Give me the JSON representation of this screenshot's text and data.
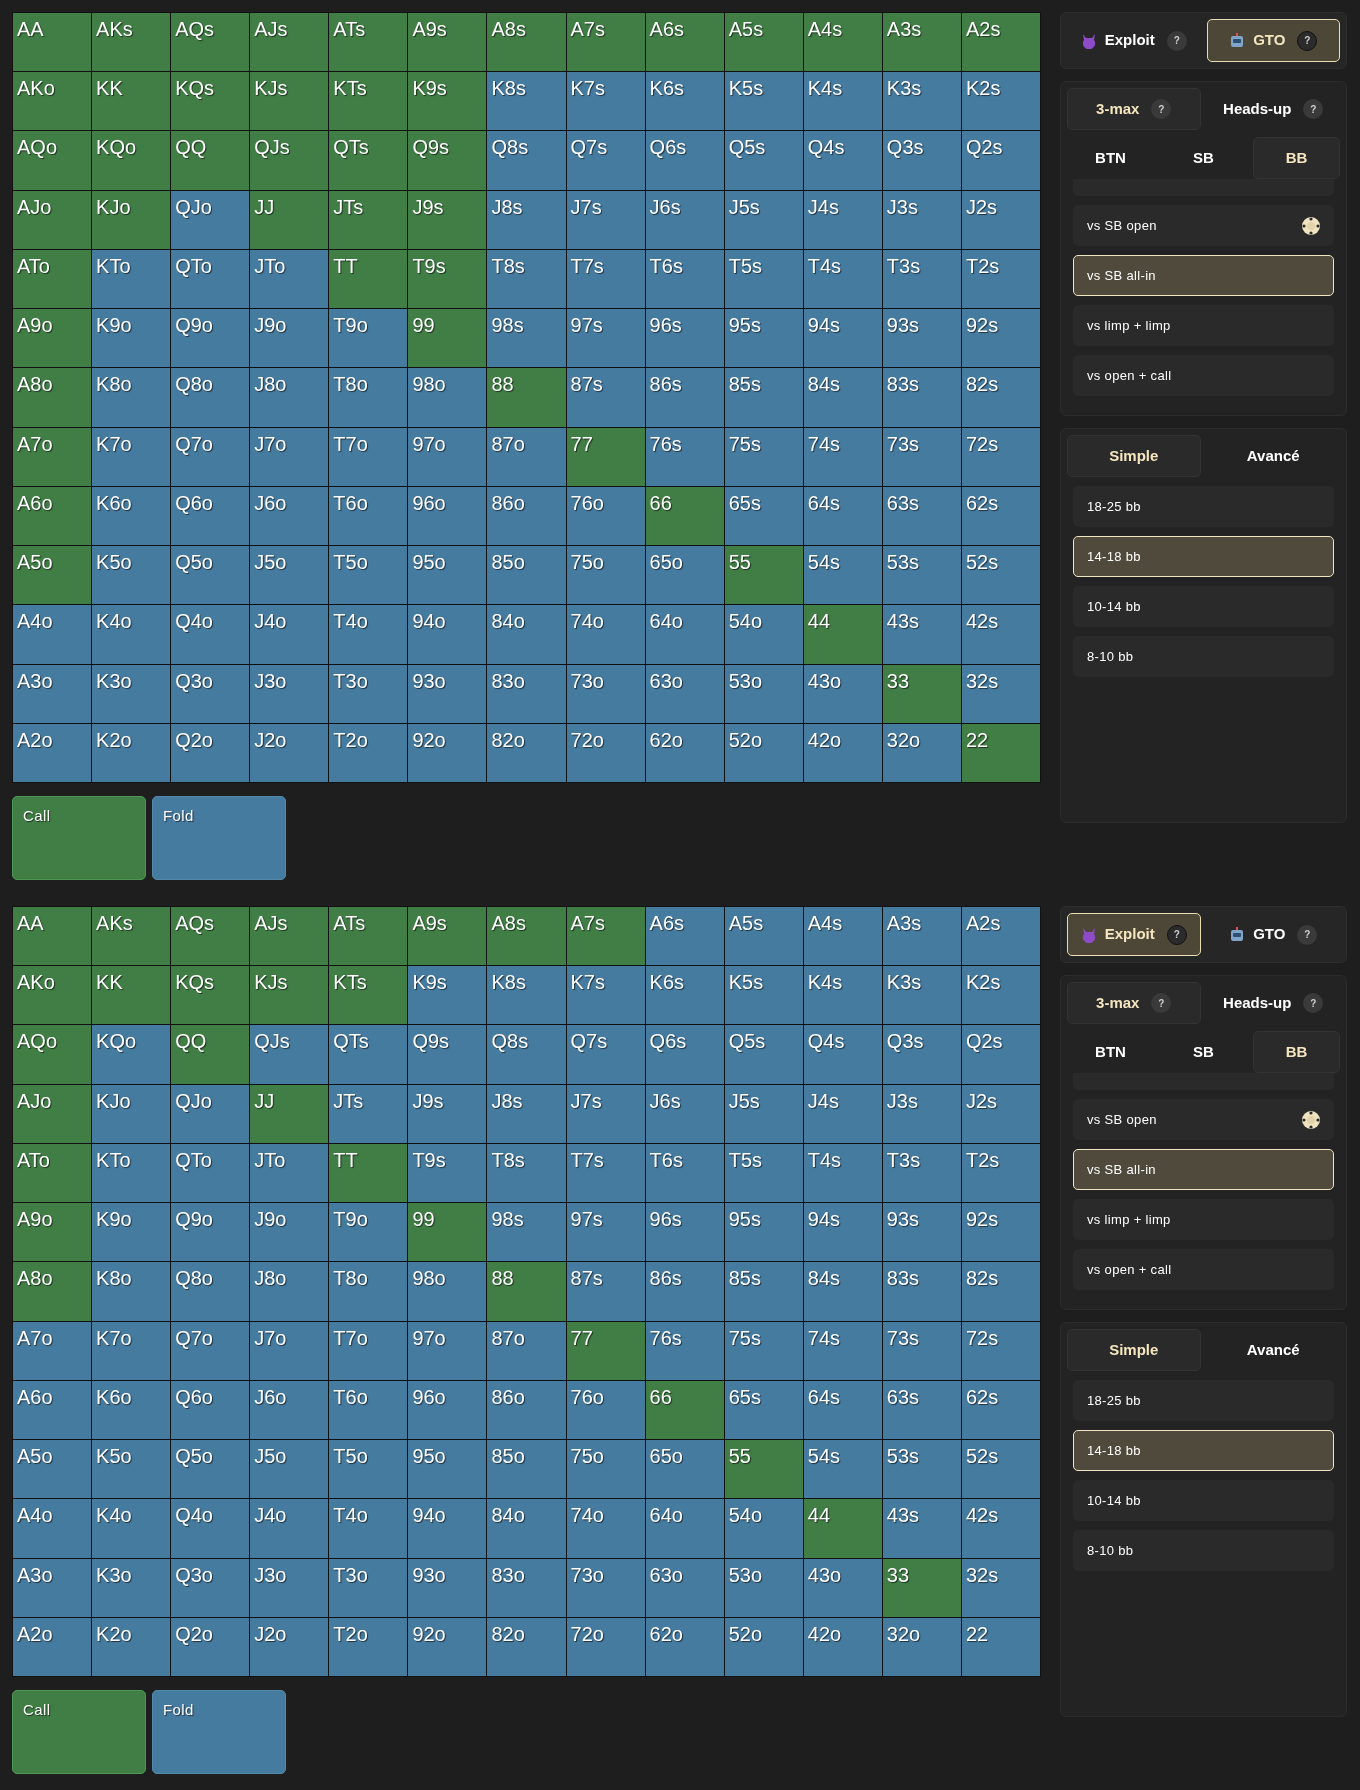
{
  "sections": [
    {
      "grid": {
        "rows": [
          {
            "cells": [
              {
                "hand": "AA",
                "kind": "call"
              },
              {
                "hand": "AKs",
                "kind": "call"
              },
              {
                "hand": "AQs",
                "kind": "call"
              },
              {
                "hand": "AJs",
                "kind": "call"
              },
              {
                "hand": "ATs",
                "kind": "call"
              },
              {
                "hand": "A9s",
                "kind": "call"
              },
              {
                "hand": "A8s",
                "kind": "call"
              },
              {
                "hand": "A7s",
                "kind": "call"
              },
              {
                "hand": "A6s",
                "kind": "call"
              },
              {
                "hand": "A5s",
                "kind": "call"
              },
              {
                "hand": "A4s",
                "kind": "call"
              },
              {
                "hand": "A3s",
                "kind": "call"
              },
              {
                "hand": "A2s",
                "kind": "call"
              }
            ]
          },
          {
            "cells": [
              {
                "hand": "AKo",
                "kind": "call"
              },
              {
                "hand": "KK",
                "kind": "call"
              },
              {
                "hand": "KQs",
                "kind": "call"
              },
              {
                "hand": "KJs",
                "kind": "call"
              },
              {
                "hand": "KTs",
                "kind": "call"
              },
              {
                "hand": "K9s",
                "kind": "call"
              },
              {
                "hand": "K8s",
                "kind": "fold"
              },
              {
                "hand": "K7s",
                "kind": "fold"
              },
              {
                "hand": "K6s",
                "kind": "fold"
              },
              {
                "hand": "K5s",
                "kind": "fold"
              },
              {
                "hand": "K4s",
                "kind": "fold"
              },
              {
                "hand": "K3s",
                "kind": "fold"
              },
              {
                "hand": "K2s",
                "kind": "fold"
              }
            ]
          },
          {
            "cells": [
              {
                "hand": "AQo",
                "kind": "call"
              },
              {
                "hand": "KQo",
                "kind": "call"
              },
              {
                "hand": "QQ",
                "kind": "call"
              },
              {
                "hand": "QJs",
                "kind": "call"
              },
              {
                "hand": "QTs",
                "kind": "call"
              },
              {
                "hand": "Q9s",
                "kind": "call"
              },
              {
                "hand": "Q8s",
                "kind": "fold"
              },
              {
                "hand": "Q7s",
                "kind": "fold"
              },
              {
                "hand": "Q6s",
                "kind": "fold"
              },
              {
                "hand": "Q5s",
                "kind": "fold"
              },
              {
                "hand": "Q4s",
                "kind": "fold"
              },
              {
                "hand": "Q3s",
                "kind": "fold"
              },
              {
                "hand": "Q2s",
                "kind": "fold"
              }
            ]
          },
          {
            "cells": [
              {
                "hand": "AJo",
                "kind": "call"
              },
              {
                "hand": "KJo",
                "kind": "call"
              },
              {
                "hand": "QJo",
                "kind": "fold"
              },
              {
                "hand": "JJ",
                "kind": "call"
              },
              {
                "hand": "JTs",
                "kind": "call"
              },
              {
                "hand": "J9s",
                "kind": "call"
              },
              {
                "hand": "J8s",
                "kind": "fold"
              },
              {
                "hand": "J7s",
                "kind": "fold"
              },
              {
                "hand": "J6s",
                "kind": "fold"
              },
              {
                "hand": "J5s",
                "kind": "fold"
              },
              {
                "hand": "J4s",
                "kind": "fold"
              },
              {
                "hand": "J3s",
                "kind": "fold"
              },
              {
                "hand": "J2s",
                "kind": "fold"
              }
            ]
          },
          {
            "cells": [
              {
                "hand": "ATo",
                "kind": "call"
              },
              {
                "hand": "KTo",
                "kind": "fold"
              },
              {
                "hand": "QTo",
                "kind": "fold"
              },
              {
                "hand": "JTo",
                "kind": "fold"
              },
              {
                "hand": "TT",
                "kind": "call"
              },
              {
                "hand": "T9s",
                "kind": "call"
              },
              {
                "hand": "T8s",
                "kind": "fold"
              },
              {
                "hand": "T7s",
                "kind": "fold"
              },
              {
                "hand": "T6s",
                "kind": "fold"
              },
              {
                "hand": "T5s",
                "kind": "fold"
              },
              {
                "hand": "T4s",
                "kind": "fold"
              },
              {
                "hand": "T3s",
                "kind": "fold"
              },
              {
                "hand": "T2s",
                "kind": "fold"
              }
            ]
          },
          {
            "cells": [
              {
                "hand": "A9o",
                "kind": "call"
              },
              {
                "hand": "K9o",
                "kind": "fold"
              },
              {
                "hand": "Q9o",
                "kind": "fold"
              },
              {
                "hand": "J9o",
                "kind": "fold"
              },
              {
                "hand": "T9o",
                "kind": "fold"
              },
              {
                "hand": "99",
                "kind": "call"
              },
              {
                "hand": "98s",
                "kind": "fold"
              },
              {
                "hand": "97s",
                "kind": "fold"
              },
              {
                "hand": "96s",
                "kind": "fold"
              },
              {
                "hand": "95s",
                "kind": "fold"
              },
              {
                "hand": "94s",
                "kind": "fold"
              },
              {
                "hand": "93s",
                "kind": "fold"
              },
              {
                "hand": "92s",
                "kind": "fold"
              }
            ]
          },
          {
            "cells": [
              {
                "hand": "A8o",
                "kind": "call"
              },
              {
                "hand": "K8o",
                "kind": "fold"
              },
              {
                "hand": "Q8o",
                "kind": "fold"
              },
              {
                "hand": "J8o",
                "kind": "fold"
              },
              {
                "hand": "T8o",
                "kind": "fold"
              },
              {
                "hand": "98o",
                "kind": "fold"
              },
              {
                "hand": "88",
                "kind": "call"
              },
              {
                "hand": "87s",
                "kind": "fold"
              },
              {
                "hand": "86s",
                "kind": "fold"
              },
              {
                "hand": "85s",
                "kind": "fold"
              },
              {
                "hand": "84s",
                "kind": "fold"
              },
              {
                "hand": "83s",
                "kind": "fold"
              },
              {
                "hand": "82s",
                "kind": "fold"
              }
            ]
          },
          {
            "cells": [
              {
                "hand": "A7o",
                "kind": "call"
              },
              {
                "hand": "K7o",
                "kind": "fold"
              },
              {
                "hand": "Q7o",
                "kind": "fold"
              },
              {
                "hand": "J7o",
                "kind": "fold"
              },
              {
                "hand": "T7o",
                "kind": "fold"
              },
              {
                "hand": "97o",
                "kind": "fold"
              },
              {
                "hand": "87o",
                "kind": "fold"
              },
              {
                "hand": "77",
                "kind": "call"
              },
              {
                "hand": "76s",
                "kind": "fold"
              },
              {
                "hand": "75s",
                "kind": "fold"
              },
              {
                "hand": "74s",
                "kind": "fold"
              },
              {
                "hand": "73s",
                "kind": "fold"
              },
              {
                "hand": "72s",
                "kind": "fold"
              }
            ]
          },
          {
            "cells": [
              {
                "hand": "A6o",
                "kind": "call"
              },
              {
                "hand": "K6o",
                "kind": "fold"
              },
              {
                "hand": "Q6o",
                "kind": "fold"
              },
              {
                "hand": "J6o",
                "kind": "fold"
              },
              {
                "hand": "T6o",
                "kind": "fold"
              },
              {
                "hand": "96o",
                "kind": "fold"
              },
              {
                "hand": "86o",
                "kind": "fold"
              },
              {
                "hand": "76o",
                "kind": "fold"
              },
              {
                "hand": "66",
                "kind": "call"
              },
              {
                "hand": "65s",
                "kind": "fold"
              },
              {
                "hand": "64s",
                "kind": "fold"
              },
              {
                "hand": "63s",
                "kind": "fold"
              },
              {
                "hand": "62s",
                "kind": "fold"
              }
            ]
          },
          {
            "cells": [
              {
                "hand": "A5o",
                "kind": "call"
              },
              {
                "hand": "K5o",
                "kind": "fold"
              },
              {
                "hand": "Q5o",
                "kind": "fold"
              },
              {
                "hand": "J5o",
                "kind": "fold"
              },
              {
                "hand": "T5o",
                "kind": "fold"
              },
              {
                "hand": "95o",
                "kind": "fold"
              },
              {
                "hand": "85o",
                "kind": "fold"
              },
              {
                "hand": "75o",
                "kind": "fold"
              },
              {
                "hand": "65o",
                "kind": "fold"
              },
              {
                "hand": "55",
                "kind": "call"
              },
              {
                "hand": "54s",
                "kind": "fold"
              },
              {
                "hand": "53s",
                "kind": "fold"
              },
              {
                "hand": "52s",
                "kind": "fold"
              }
            ]
          },
          {
            "cells": [
              {
                "hand": "A4o",
                "kind": "fold"
              },
              {
                "hand": "K4o",
                "kind": "fold"
              },
              {
                "hand": "Q4o",
                "kind": "fold"
              },
              {
                "hand": "J4o",
                "kind": "fold"
              },
              {
                "hand": "T4o",
                "kind": "fold"
              },
              {
                "hand": "94o",
                "kind": "fold"
              },
              {
                "hand": "84o",
                "kind": "fold"
              },
              {
                "hand": "74o",
                "kind": "fold"
              },
              {
                "hand": "64o",
                "kind": "fold"
              },
              {
                "hand": "54o",
                "kind": "fold"
              },
              {
                "hand": "44",
                "kind": "call"
              },
              {
                "hand": "43s",
                "kind": "fold"
              },
              {
                "hand": "42s",
                "kind": "fold"
              }
            ]
          },
          {
            "cells": [
              {
                "hand": "A3o",
                "kind": "fold"
              },
              {
                "hand": "K3o",
                "kind": "fold"
              },
              {
                "hand": "Q3o",
                "kind": "fold"
              },
              {
                "hand": "J3o",
                "kind": "fold"
              },
              {
                "hand": "T3o",
                "kind": "fold"
              },
              {
                "hand": "93o",
                "kind": "fold"
              },
              {
                "hand": "83o",
                "kind": "fold"
              },
              {
                "hand": "73o",
                "kind": "fold"
              },
              {
                "hand": "63o",
                "kind": "fold"
              },
              {
                "hand": "53o",
                "kind": "fold"
              },
              {
                "hand": "43o",
                "kind": "fold"
              },
              {
                "hand": "33",
                "kind": "call"
              },
              {
                "hand": "32s",
                "kind": "fold"
              }
            ]
          },
          {
            "cells": [
              {
                "hand": "A2o",
                "kind": "fold"
              },
              {
                "hand": "K2o",
                "kind": "fold"
              },
              {
                "hand": "Q2o",
                "kind": "fold"
              },
              {
                "hand": "J2o",
                "kind": "fold"
              },
              {
                "hand": "T2o",
                "kind": "fold"
              },
              {
                "hand": "92o",
                "kind": "fold"
              },
              {
                "hand": "82o",
                "kind": "fold"
              },
              {
                "hand": "72o",
                "kind": "fold"
              },
              {
                "hand": "62o",
                "kind": "fold"
              },
              {
                "hand": "52o",
                "kind": "fold"
              },
              {
                "hand": "42o",
                "kind": "fold"
              },
              {
                "hand": "32o",
                "kind": "fold"
              },
              {
                "hand": "22",
                "kind": "call"
              }
            ]
          }
        ]
      },
      "legend": [
        {
          "label": "Call",
          "kind": "call"
        },
        {
          "label": "Fold",
          "kind": "fold"
        }
      ],
      "panel": {
        "modes": [
          {
            "label": "Exploit",
            "kind": "devil",
            "help": "?",
            "selected": false
          },
          {
            "label": "GTO",
            "kind": "robot",
            "help": "?",
            "selected": true
          }
        ],
        "formats": [
          {
            "label": "3-max",
            "help": "?",
            "selected": true
          },
          {
            "label": "Heads-up",
            "help": "?",
            "selected": false
          }
        ],
        "positions": [
          {
            "label": "BTN",
            "selected": false
          },
          {
            "label": "SB",
            "selected": false
          },
          {
            "label": "BB",
            "selected": true
          }
        ],
        "scenarios": [
          {
            "selected": false,
            "chip": false
          },
          {
            "label": "vs SB open",
            "selected": false,
            "chip": true
          },
          {
            "label": "vs SB all-in",
            "selected": true,
            "chip": false
          },
          {
            "label": "vs limp + limp",
            "selected": false,
            "chip": false
          },
          {
            "label": "vs open + call",
            "selected": false,
            "chip": false
          }
        ],
        "levels": [
          {
            "label": "Simple",
            "selected": true
          },
          {
            "label": "Avancé",
            "selected": false
          }
        ],
        "stacks": [
          {
            "label": "18-25 bb",
            "selected": false
          },
          {
            "label": "14-18 bb",
            "selected": true
          },
          {
            "label": "10-14 bb",
            "selected": false
          },
          {
            "label": "8-10 bb",
            "selected": false
          }
        ]
      }
    },
    {
      "grid": {
        "rows": [
          {
            "cells": [
              {
                "hand": "AA",
                "kind": "call"
              },
              {
                "hand": "AKs",
                "kind": "call"
              },
              {
                "hand": "AQs",
                "kind": "call"
              },
              {
                "hand": "AJs",
                "kind": "call"
              },
              {
                "hand": "ATs",
                "kind": "call"
              },
              {
                "hand": "A9s",
                "kind": "call"
              },
              {
                "hand": "A8s",
                "kind": "call"
              },
              {
                "hand": "A7s",
                "kind": "call"
              },
              {
                "hand": "A6s",
                "kind": "fold"
              },
              {
                "hand": "A5s",
                "kind": "fold"
              },
              {
                "hand": "A4s",
                "kind": "fold"
              },
              {
                "hand": "A3s",
                "kind": "fold"
              },
              {
                "hand": "A2s",
                "kind": "fold"
              }
            ]
          },
          {
            "cells": [
              {
                "hand": "AKo",
                "kind": "call"
              },
              {
                "hand": "KK",
                "kind": "call"
              },
              {
                "hand": "KQs",
                "kind": "call"
              },
              {
                "hand": "KJs",
                "kind": "call"
              },
              {
                "hand": "KTs",
                "kind": "call"
              },
              {
                "hand": "K9s",
                "kind": "fold"
              },
              {
                "hand": "K8s",
                "kind": "fold"
              },
              {
                "hand": "K7s",
                "kind": "fold"
              },
              {
                "hand": "K6s",
                "kind": "fold"
              },
              {
                "hand": "K5s",
                "kind": "fold"
              },
              {
                "hand": "K4s",
                "kind": "fold"
              },
              {
                "hand": "K3s",
                "kind": "fold"
              },
              {
                "hand": "K2s",
                "kind": "fold"
              }
            ]
          },
          {
            "cells": [
              {
                "hand": "AQo",
                "kind": "call"
              },
              {
                "hand": "KQo",
                "kind": "fold"
              },
              {
                "hand": "QQ",
                "kind": "call"
              },
              {
                "hand": "QJs",
                "kind": "fold"
              },
              {
                "hand": "QTs",
                "kind": "fold"
              },
              {
                "hand": "Q9s",
                "kind": "fold"
              },
              {
                "hand": "Q8s",
                "kind": "fold"
              },
              {
                "hand": "Q7s",
                "kind": "fold"
              },
              {
                "hand": "Q6s",
                "kind": "fold"
              },
              {
                "hand": "Q5s",
                "kind": "fold"
              },
              {
                "hand": "Q4s",
                "kind": "fold"
              },
              {
                "hand": "Q3s",
                "kind": "fold"
              },
              {
                "hand": "Q2s",
                "kind": "fold"
              }
            ]
          },
          {
            "cells": [
              {
                "hand": "AJo",
                "kind": "call"
              },
              {
                "hand": "KJo",
                "kind": "fold"
              },
              {
                "hand": "QJo",
                "kind": "fold"
              },
              {
                "hand": "JJ",
                "kind": "call"
              },
              {
                "hand": "JTs",
                "kind": "fold"
              },
              {
                "hand": "J9s",
                "kind": "fold"
              },
              {
                "hand": "J8s",
                "kind": "fold"
              },
              {
                "hand": "J7s",
                "kind": "fold"
              },
              {
                "hand": "J6s",
                "kind": "fold"
              },
              {
                "hand": "J5s",
                "kind": "fold"
              },
              {
                "hand": "J4s",
                "kind": "fold"
              },
              {
                "hand": "J3s",
                "kind": "fold"
              },
              {
                "hand": "J2s",
                "kind": "fold"
              }
            ]
          },
          {
            "cells": [
              {
                "hand": "ATo",
                "kind": "call"
              },
              {
                "hand": "KTo",
                "kind": "fold"
              },
              {
                "hand": "QTo",
                "kind": "fold"
              },
              {
                "hand": "JTo",
                "kind": "fold"
              },
              {
                "hand": "TT",
                "kind": "call"
              },
              {
                "hand": "T9s",
                "kind": "fold"
              },
              {
                "hand": "T8s",
                "kind": "fold"
              },
              {
                "hand": "T7s",
                "kind": "fold"
              },
              {
                "hand": "T6s",
                "kind": "fold"
              },
              {
                "hand": "T5s",
                "kind": "fold"
              },
              {
                "hand": "T4s",
                "kind": "fold"
              },
              {
                "hand": "T3s",
                "kind": "fold"
              },
              {
                "hand": "T2s",
                "kind": "fold"
              }
            ]
          },
          {
            "cells": [
              {
                "hand": "A9o",
                "kind": "call"
              },
              {
                "hand": "K9o",
                "kind": "fold"
              },
              {
                "hand": "Q9o",
                "kind": "fold"
              },
              {
                "hand": "J9o",
                "kind": "fold"
              },
              {
                "hand": "T9o",
                "kind": "fold"
              },
              {
                "hand": "99",
                "kind": "call"
              },
              {
                "hand": "98s",
                "kind": "fold"
              },
              {
                "hand": "97s",
                "kind": "fold"
              },
              {
                "hand": "96s",
                "kind": "fold"
              },
              {
                "hand": "95s",
                "kind": "fold"
              },
              {
                "hand": "94s",
                "kind": "fold"
              },
              {
                "hand": "93s",
                "kind": "fold"
              },
              {
                "hand": "92s",
                "kind": "fold"
              }
            ]
          },
          {
            "cells": [
              {
                "hand": "A8o",
                "kind": "call"
              },
              {
                "hand": "K8o",
                "kind": "fold"
              },
              {
                "hand": "Q8o",
                "kind": "fold"
              },
              {
                "hand": "J8o",
                "kind": "fold"
              },
              {
                "hand": "T8o",
                "kind": "fold"
              },
              {
                "hand": "98o",
                "kind": "fold"
              },
              {
                "hand": "88",
                "kind": "call"
              },
              {
                "hand": "87s",
                "kind": "fold"
              },
              {
                "hand": "86s",
                "kind": "fold"
              },
              {
                "hand": "85s",
                "kind": "fold"
              },
              {
                "hand": "84s",
                "kind": "fold"
              },
              {
                "hand": "83s",
                "kind": "fold"
              },
              {
                "hand": "82s",
                "kind": "fold"
              }
            ]
          },
          {
            "cells": [
              {
                "hand": "A7o",
                "kind": "fold"
              },
              {
                "hand": "K7o",
                "kind": "fold"
              },
              {
                "hand": "Q7o",
                "kind": "fold"
              },
              {
                "hand": "J7o",
                "kind": "fold"
              },
              {
                "hand": "T7o",
                "kind": "fold"
              },
              {
                "hand": "97o",
                "kind": "fold"
              },
              {
                "hand": "87o",
                "kind": "fold"
              },
              {
                "hand": "77",
                "kind": "call"
              },
              {
                "hand": "76s",
                "kind": "fold"
              },
              {
                "hand": "75s",
                "kind": "fold"
              },
              {
                "hand": "74s",
                "kind": "fold"
              },
              {
                "hand": "73s",
                "kind": "fold"
              },
              {
                "hand": "72s",
                "kind": "fold"
              }
            ]
          },
          {
            "cells": [
              {
                "hand": "A6o",
                "kind": "fold"
              },
              {
                "hand": "K6o",
                "kind": "fold"
              },
              {
                "hand": "Q6o",
                "kind": "fold"
              },
              {
                "hand": "J6o",
                "kind": "fold"
              },
              {
                "hand": "T6o",
                "kind": "fold"
              },
              {
                "hand": "96o",
                "kind": "fold"
              },
              {
                "hand": "86o",
                "kind": "fold"
              },
              {
                "hand": "76o",
                "kind": "fold"
              },
              {
                "hand": "66",
                "kind": "call"
              },
              {
                "hand": "65s",
                "kind": "fold"
              },
              {
                "hand": "64s",
                "kind": "fold"
              },
              {
                "hand": "63s",
                "kind": "fold"
              },
              {
                "hand": "62s",
                "kind": "fold"
              }
            ]
          },
          {
            "cells": [
              {
                "hand": "A5o",
                "kind": "fold"
              },
              {
                "hand": "K5o",
                "kind": "fold"
              },
              {
                "hand": "Q5o",
                "kind": "fold"
              },
              {
                "hand": "J5o",
                "kind": "fold"
              },
              {
                "hand": "T5o",
                "kind": "fold"
              },
              {
                "hand": "95o",
                "kind": "fold"
              },
              {
                "hand": "85o",
                "kind": "fold"
              },
              {
                "hand": "75o",
                "kind": "fold"
              },
              {
                "hand": "65o",
                "kind": "fold"
              },
              {
                "hand": "55",
                "kind": "call"
              },
              {
                "hand": "54s",
                "kind": "fold"
              },
              {
                "hand": "53s",
                "kind": "fold"
              },
              {
                "hand": "52s",
                "kind": "fold"
              }
            ]
          },
          {
            "cells": [
              {
                "hand": "A4o",
                "kind": "fold"
              },
              {
                "hand": "K4o",
                "kind": "fold"
              },
              {
                "hand": "Q4o",
                "kind": "fold"
              },
              {
                "hand": "J4o",
                "kind": "fold"
              },
              {
                "hand": "T4o",
                "kind": "fold"
              },
              {
                "hand": "94o",
                "kind": "fold"
              },
              {
                "hand": "84o",
                "kind": "fold"
              },
              {
                "hand": "74o",
                "kind": "fold"
              },
              {
                "hand": "64o",
                "kind": "fold"
              },
              {
                "hand": "54o",
                "kind": "fold"
              },
              {
                "hand": "44",
                "kind": "call"
              },
              {
                "hand": "43s",
                "kind": "fold"
              },
              {
                "hand": "42s",
                "kind": "fold"
              }
            ]
          },
          {
            "cells": [
              {
                "hand": "A3o",
                "kind": "fold"
              },
              {
                "hand": "K3o",
                "kind": "fold"
              },
              {
                "hand": "Q3o",
                "kind": "fold"
              },
              {
                "hand": "J3o",
                "kind": "fold"
              },
              {
                "hand": "T3o",
                "kind": "fold"
              },
              {
                "hand": "93o",
                "kind": "fold"
              },
              {
                "hand": "83o",
                "kind": "fold"
              },
              {
                "hand": "73o",
                "kind": "fold"
              },
              {
                "hand": "63o",
                "kind": "fold"
              },
              {
                "hand": "53o",
                "kind": "fold"
              },
              {
                "hand": "43o",
                "kind": "fold"
              },
              {
                "hand": "33",
                "kind": "call"
              },
              {
                "hand": "32s",
                "kind": "fold"
              }
            ]
          },
          {
            "cells": [
              {
                "hand": "A2o",
                "kind": "fold"
              },
              {
                "hand": "K2o",
                "kind": "fold"
              },
              {
                "hand": "Q2o",
                "kind": "fold"
              },
              {
                "hand": "J2o",
                "kind": "fold"
              },
              {
                "hand": "T2o",
                "kind": "fold"
              },
              {
                "hand": "92o",
                "kind": "fold"
              },
              {
                "hand": "82o",
                "kind": "fold"
              },
              {
                "hand": "72o",
                "kind": "fold"
              },
              {
                "hand": "62o",
                "kind": "fold"
              },
              {
                "hand": "52o",
                "kind": "fold"
              },
              {
                "hand": "42o",
                "kind": "fold"
              },
              {
                "hand": "32o",
                "kind": "fold"
              },
              {
                "hand": "22",
                "kind": "fold"
              }
            ]
          }
        ]
      },
      "legend": [
        {
          "label": "Call",
          "kind": "call"
        },
        {
          "label": "Fold",
          "kind": "fold"
        }
      ],
      "panel": {
        "modes": [
          {
            "label": "Exploit",
            "kind": "devil",
            "help": "?",
            "selected": true
          },
          {
            "label": "GTO",
            "kind": "robot",
            "help": "?",
            "selected": false
          }
        ],
        "formats": [
          {
            "label": "3-max",
            "help": "?",
            "selected": true
          },
          {
            "label": "Heads-up",
            "help": "?",
            "selected": false
          }
        ],
        "positions": [
          {
            "label": "BTN",
            "selected": false
          },
          {
            "label": "SB",
            "selected": false
          },
          {
            "label": "BB",
            "selected": true
          }
        ],
        "scenarios": [
          {
            "selected": false,
            "chip": false
          },
          {
            "label": "vs SB open",
            "selected": false,
            "chip": true
          },
          {
            "label": "vs SB all-in",
            "selected": true,
            "chip": false
          },
          {
            "label": "vs limp + limp",
            "selected": false,
            "chip": false
          },
          {
            "label": "vs open + call",
            "selected": false,
            "chip": false
          }
        ],
        "levels": [
          {
            "label": "Simple",
            "selected": true
          },
          {
            "label": "Avancé",
            "selected": false
          }
        ],
        "stacks": [
          {
            "label": "18-25 bb",
            "selected": false
          },
          {
            "label": "14-18 bb",
            "selected": true
          },
          {
            "label": "10-14 bb",
            "selected": false
          },
          {
            "label": "8-10 bb",
            "selected": false
          }
        ]
      }
    }
  ]
}
